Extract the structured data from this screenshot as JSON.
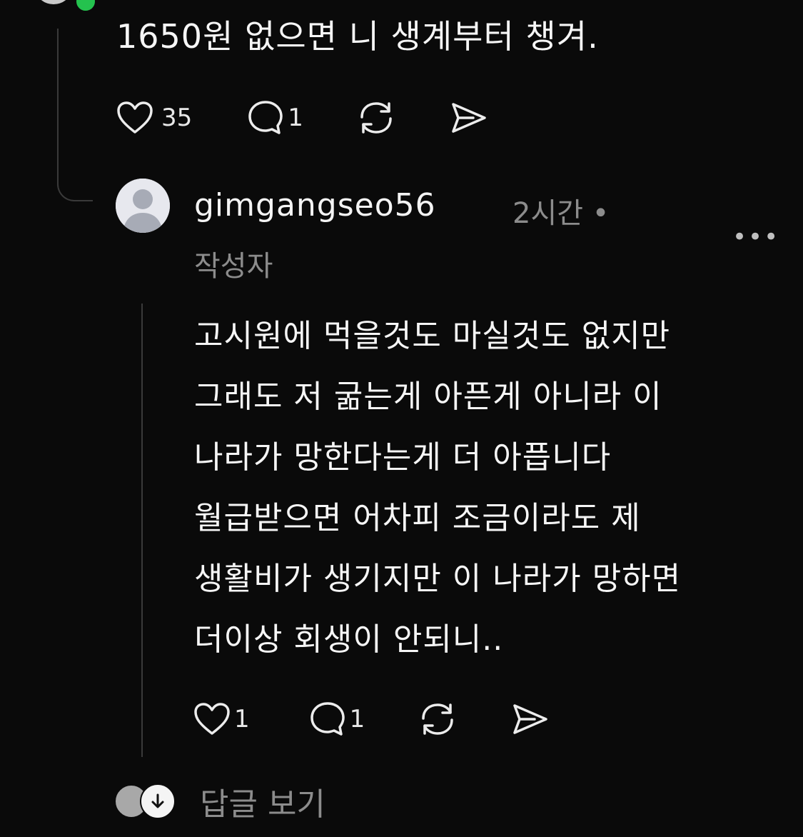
{
  "post": {
    "text": "1650원 없으면 니 생계부터 챙겨.",
    "likes": "35",
    "comments": "1"
  },
  "reply": {
    "username": "gimgangseo56",
    "time": "2시간 •",
    "role": "작성자",
    "more_icon": "•••",
    "lines": [
      "고시원에 먹을것도 마실것도 없지만",
      "그래도 저 굶는게 아픈게 아니라 이",
      "나라가 망한다는게 더 아픕니다",
      "월급받으면 어차피 조금이라도 제",
      "생활비가 생기지만 이 나라가 망하면",
      "더이상 회생이 안되니.."
    ],
    "likes": "1",
    "comments": "1"
  },
  "replies": {
    "label": "답글 보기"
  },
  "colors": {
    "background": "#0a0a0a",
    "text": "#f6f6f6",
    "muted": "#8c8c8c",
    "online": "#24c24e"
  },
  "icons": [
    "heart-icon",
    "comment-icon",
    "repost-icon",
    "send-icon",
    "more-icon",
    "arrow-down-icon",
    "user-placeholder-icon"
  ]
}
